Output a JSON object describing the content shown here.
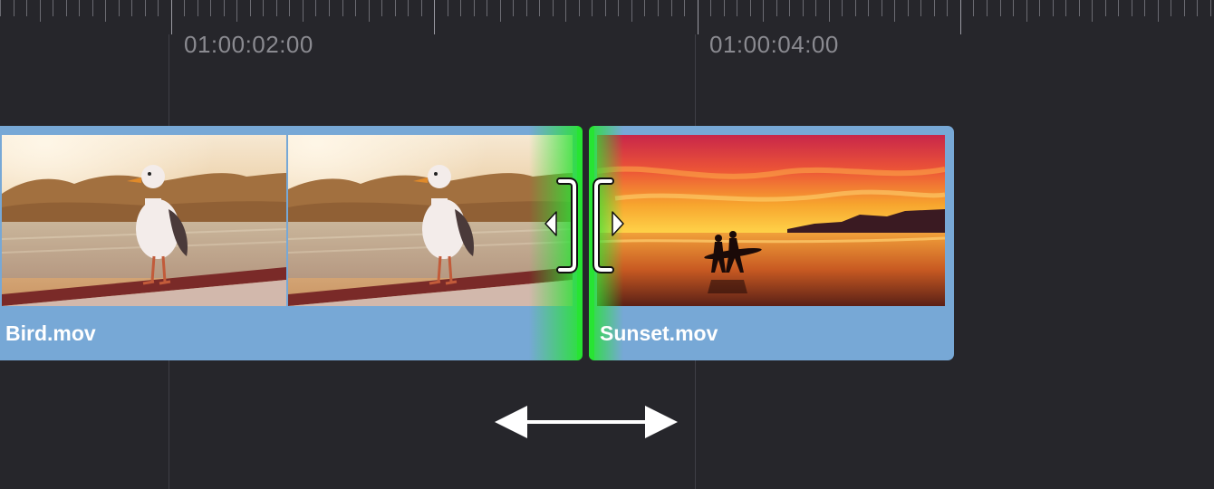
{
  "ruler": {
    "timecodes": [
      "01:00:02:00",
      "01:00:04:00"
    ]
  },
  "clips": {
    "bird": {
      "label": "Bird.mov"
    },
    "sunset": {
      "label": "Sunset.mov"
    }
  },
  "edit_point": {
    "highlight_color": "#27e433",
    "left_handle_icon": "trim-bracket-right-icon",
    "right_handle_icon": "trim-bracket-left-icon",
    "left_arrow_icon": "arrow-left-icon",
    "right_arrow_icon": "arrow-right-icon"
  },
  "drag_indicator": {
    "icon": "double-arrow-horizontal-icon"
  },
  "colors": {
    "background": "#26262b",
    "clip": "#77a8d6",
    "timecode": "#8a8a90"
  }
}
